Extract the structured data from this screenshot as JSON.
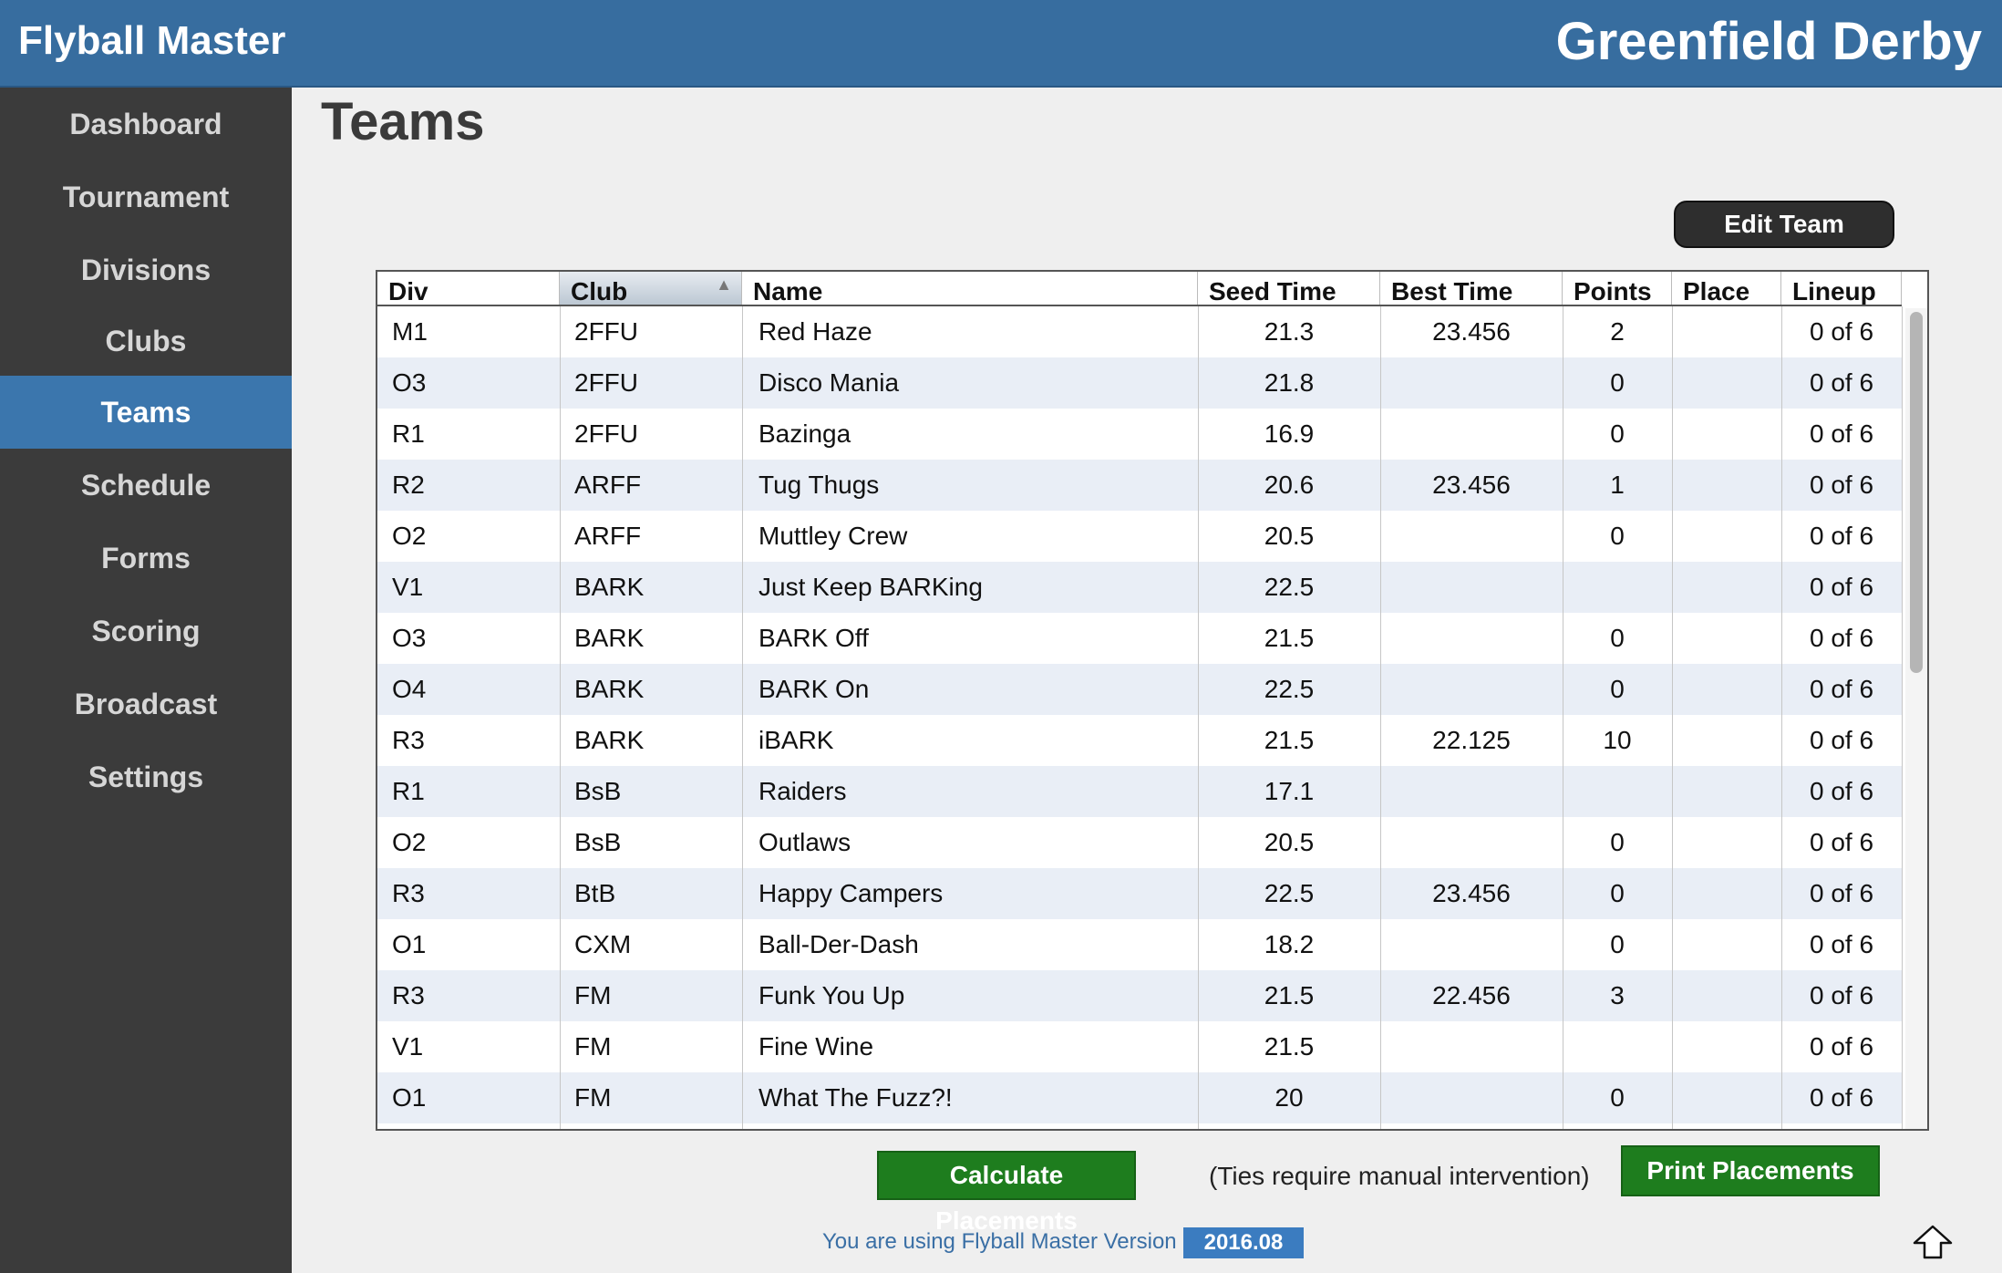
{
  "header": {
    "app_title": "Flyball Master",
    "event_title": "Greenfield Derby"
  },
  "sidebar": {
    "items": [
      {
        "label": "Dashboard"
      },
      {
        "label": "Tournament"
      },
      {
        "label": "Divisions"
      },
      {
        "label": "Clubs"
      },
      {
        "label": "Teams",
        "active": true
      },
      {
        "label": "Schedule"
      },
      {
        "label": "Forms"
      },
      {
        "label": "Scoring"
      },
      {
        "label": "Broadcast"
      },
      {
        "label": "Settings"
      }
    ]
  },
  "page": {
    "title": "Teams",
    "edit_button": "Edit Team"
  },
  "table": {
    "columns": [
      "Div",
      "Club",
      "Name",
      "Seed Time",
      "Best Time",
      "Points",
      "Place",
      "Lineup"
    ],
    "sorted_column": "Club",
    "rows": [
      [
        "M1",
        "2FFU",
        "Red Haze",
        "21.3",
        "23.456",
        "2",
        "",
        "0 of 6"
      ],
      [
        "O3",
        "2FFU",
        "Disco Mania",
        "21.8",
        "",
        "0",
        "",
        "0 of 6"
      ],
      [
        "R1",
        "2FFU",
        "Bazinga",
        "16.9",
        "",
        "0",
        "",
        "0 of 6"
      ],
      [
        "R2",
        "ARFF",
        "Tug Thugs",
        "20.6",
        "23.456",
        "1",
        "",
        "0 of 6"
      ],
      [
        "O2",
        "ARFF",
        "Muttley Crew",
        "20.5",
        "",
        "0",
        "",
        "0 of 6"
      ],
      [
        "V1",
        "BARK",
        "Just Keep BARKing",
        "22.5",
        "",
        "",
        "",
        "0 of 6"
      ],
      [
        "O3",
        "BARK",
        "BARK Off",
        "21.5",
        "",
        "0",
        "",
        "0 of 6"
      ],
      [
        "O4",
        "BARK",
        "BARK On",
        "22.5",
        "",
        "0",
        "",
        "0 of 6"
      ],
      [
        "R3",
        "BARK",
        "iBARK",
        "21.5",
        "22.125",
        "10",
        "",
        "0 of 6"
      ],
      [
        "R1",
        "BsB",
        "Raiders",
        "17.1",
        "",
        "",
        "",
        "0 of 6"
      ],
      [
        "O2",
        "BsB",
        "Outlaws",
        "20.5",
        "",
        "0",
        "",
        "0 of 6"
      ],
      [
        "R3",
        "BtB",
        "Happy Campers",
        "22.5",
        "23.456",
        "0",
        "",
        "0 of 6"
      ],
      [
        "O1",
        "CXM",
        "Ball-Der-Dash",
        "18.2",
        "",
        "0",
        "",
        "0 of 6"
      ],
      [
        "R3",
        "FM",
        "Funk You Up",
        "21.5",
        "22.456",
        "3",
        "",
        "0 of 6"
      ],
      [
        "V1",
        "FM",
        "Fine Wine",
        "21.5",
        "",
        "",
        "",
        "0 of 6"
      ],
      [
        "O1",
        "FM",
        "What The Fuzz?!",
        "20",
        "",
        "0",
        "",
        "0 of 6"
      ]
    ]
  },
  "actions": {
    "calculate_label": "Calculate Placements",
    "ties_note": "(Ties require manual intervention)",
    "print_label": "Print Placements"
  },
  "footer": {
    "version_text": "You are using Flyball Master Version",
    "version": "2016.08"
  },
  "icons": {
    "scroll_top": "up-arrow-icon",
    "sort": "sort-ascending-icon"
  },
  "colors": {
    "header": "#376d9f",
    "sidebar": "#3b3b3b",
    "active_nav": "#3b76ad",
    "action_green": "#1e7d1e",
    "row_alt": "#e9eef6"
  }
}
